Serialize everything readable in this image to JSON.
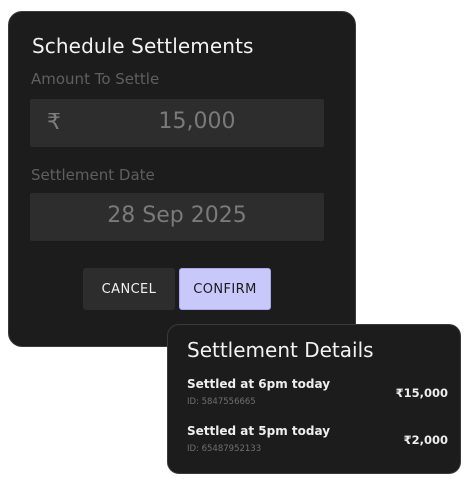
{
  "schedule": {
    "title": "Schedule Settlements",
    "amount_label": "Amount To Settle",
    "currency_symbol": "₹",
    "amount_value": "15,000",
    "date_label": "Settlement Date",
    "date_value": "28 Sep 2025",
    "cancel_label": "CANCEL",
    "confirm_label": "CONFIRM"
  },
  "details": {
    "title": "Settlement Details",
    "rows": [
      {
        "title": "Settled at 6pm today",
        "id": "ID: 5847556665",
        "amount": "₹15,000"
      },
      {
        "title": "Settled at 5pm today",
        "id": "ID: 65487952133",
        "amount": "₹2,000"
      }
    ]
  },
  "colors": {
    "card_background": "#1c1c1c",
    "field_background": "#2d2d2d",
    "confirm_accent": "#c9c8fb"
  }
}
